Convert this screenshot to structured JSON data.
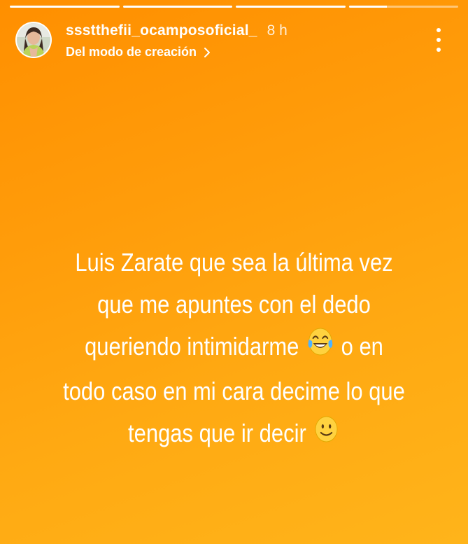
{
  "progress": [
    1,
    1,
    1,
    0.35
  ],
  "header": {
    "username": "ssstthefii_ocamposoficial_",
    "time": "8 h",
    "subtitle": "Del modo de creación"
  },
  "caption": {
    "lines": [
      "Luis Zarate que sea la última vez",
      "que me apuntes con el dedo",
      "queriendo intimidarme",
      "o en",
      "todo caso en mi cara decime lo que",
      "tengas que ir decir"
    ],
    "emojis": [
      "tears-of-joy",
      "slightly-smiling"
    ]
  },
  "icons": [
    "avatar",
    "chevron-right-icon",
    "more-options-icon"
  ],
  "colors": {
    "background_top": "#ff8f00",
    "background_bottom": "#ffb41a",
    "text": "#ffffff"
  }
}
